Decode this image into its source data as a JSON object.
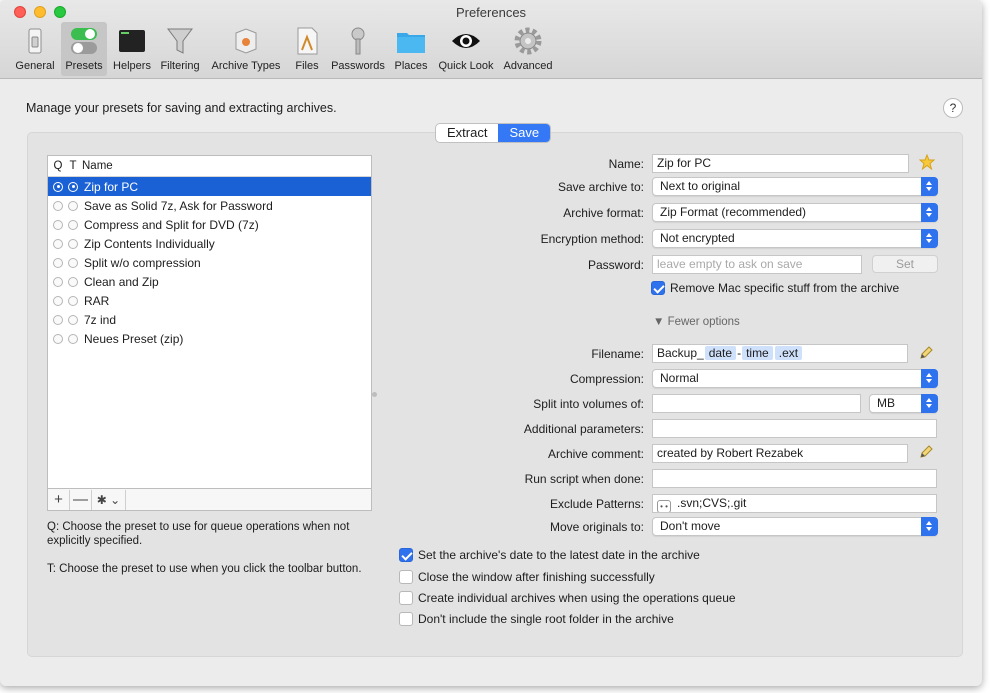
{
  "window": {
    "title": "Preferences"
  },
  "toolbar": {
    "items": [
      {
        "label": "General",
        "icon": "switch-icon",
        "selected": false
      },
      {
        "label": "Presets",
        "icon": "toggles-icon",
        "selected": true
      },
      {
        "label": "Helpers",
        "icon": "terminal-icon",
        "selected": false
      },
      {
        "label": "Filtering",
        "icon": "funnel-icon",
        "selected": false
      },
      {
        "label": "Archive Types",
        "icon": "package-icon",
        "selected": false
      },
      {
        "label": "Files",
        "icon": "document-icon",
        "selected": false
      },
      {
        "label": "Passwords",
        "icon": "key-icon",
        "selected": false
      },
      {
        "label": "Places",
        "icon": "folder-icon",
        "selected": false
      },
      {
        "label": "Quick Look",
        "icon": "eye-icon",
        "selected": false
      },
      {
        "label": "Advanced",
        "icon": "gear-icon",
        "selected": false
      }
    ]
  },
  "main": {
    "headline": "Manage your presets for saving and extracting archives.",
    "help": "?",
    "tabs": [
      {
        "label": "Extract",
        "selected": false
      },
      {
        "label": "Save",
        "selected": true
      }
    ]
  },
  "presets": {
    "columns": {
      "q": "Q",
      "t": "T",
      "name": "Name"
    },
    "rows": [
      {
        "name": "Zip for PC",
        "selected": true
      },
      {
        "name": "Save as Solid 7z, Ask for Password",
        "selected": false
      },
      {
        "name": "Compress and Split for DVD (7z)",
        "selected": false
      },
      {
        "name": "Zip Contents Individually",
        "selected": false
      },
      {
        "name": "Split w/o compression",
        "selected": false
      },
      {
        "name": "Clean and Zip",
        "selected": false
      },
      {
        "name": "RAR",
        "selected": false
      },
      {
        "name": "7z ind",
        "selected": false
      },
      {
        "name": "Neues Preset (zip)",
        "selected": false
      }
    ],
    "bar": {
      "add": "+",
      "remove": "—",
      "actions": "✱ ⌄"
    },
    "note_q": "Q: Choose the preset to use for queue operations when not explicitly specified.",
    "note_t": "T: Choose the preset to use when you click the toolbar button."
  },
  "form": {
    "name": {
      "label": "Name:",
      "value": "Zip for PC"
    },
    "save_to": {
      "label": "Save archive to:",
      "value": "Next to original"
    },
    "format": {
      "label": "Archive format:",
      "value": "Zip Format (recommended)"
    },
    "encryption": {
      "label": "Encryption method:",
      "value": "Not encrypted"
    },
    "password": {
      "label": "Password:",
      "placeholder": "leave empty to ask on save",
      "set_button": "Set"
    },
    "remove_mac": {
      "label": "Remove Mac specific stuff from the archive",
      "checked": true
    },
    "fewer_options": "▼ Fewer options",
    "filename": {
      "label": "Filename:",
      "prefix": "Backup_",
      "token1": "date",
      "sep": "-",
      "token2": "time",
      "token3": ".ext"
    },
    "compression": {
      "label": "Compression:",
      "value": "Normal"
    },
    "split": {
      "label": "Split into volumes of:",
      "value": "",
      "unit": "MB"
    },
    "additional": {
      "label": "Additional parameters:",
      "value": ""
    },
    "comment": {
      "label": "Archive comment:",
      "value": "created by Robert Rezabek"
    },
    "script": {
      "label": "Run script when done:",
      "value": ""
    },
    "exclude": {
      "label": "Exclude Patterns:",
      "value": ".svn;CVS;.git"
    },
    "move": {
      "label": "Move originals to:",
      "value": "Don't move"
    }
  },
  "options": [
    {
      "label": "Set the archive's date to the latest date in the archive",
      "checked": true
    },
    {
      "label": "Close the window after finishing successfully",
      "checked": false
    },
    {
      "label": "Create individual archives when using the operations queue",
      "checked": false
    },
    {
      "label": "Don't include the single root folder in the archive",
      "checked": false
    }
  ],
  "colors": {
    "accent": "#2f72ee",
    "selection": "#1b61d6"
  }
}
